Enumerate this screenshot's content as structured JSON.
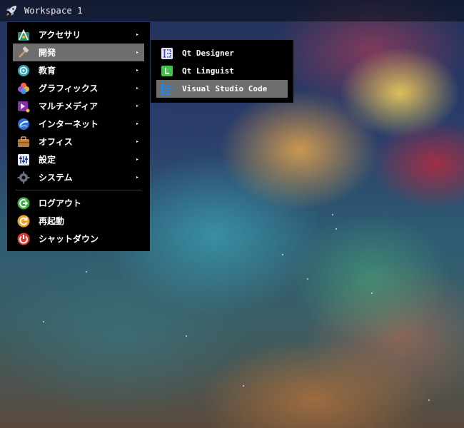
{
  "taskbar": {
    "workspace_label": "Workspace 1",
    "launcher_icon": "rocket-icon"
  },
  "main_menu": {
    "categories": [
      {
        "label": "アクセサリ",
        "icon": "accessories-icon",
        "has_submenu": true,
        "active": false
      },
      {
        "label": "開発",
        "icon": "hammer-icon",
        "has_submenu": true,
        "active": true
      },
      {
        "label": "教育",
        "icon": "education-icon",
        "has_submenu": true,
        "active": false
      },
      {
        "label": "グラフィックス",
        "icon": "graphics-icon",
        "has_submenu": true,
        "active": false
      },
      {
        "label": "マルチメディア",
        "icon": "multimedia-icon",
        "has_submenu": true,
        "active": false
      },
      {
        "label": "インターネット",
        "icon": "internet-icon",
        "has_submenu": true,
        "active": false
      },
      {
        "label": "オフィス",
        "icon": "office-icon",
        "has_submenu": true,
        "active": false
      },
      {
        "label": "設定",
        "icon": "settings-icon",
        "has_submenu": true,
        "active": false
      },
      {
        "label": "システム",
        "icon": "system-gear-icon",
        "has_submenu": true,
        "active": false
      }
    ],
    "session": [
      {
        "label": "ログアウト",
        "icon": "logout-icon"
      },
      {
        "label": "再起動",
        "icon": "restart-icon"
      },
      {
        "label": "シャットダウン",
        "icon": "shutdown-icon"
      }
    ],
    "submenu_arrow": "▸"
  },
  "sub_menu": {
    "parent": "開発",
    "items": [
      {
        "label": "Qt Designer",
        "icon": "qt-designer-icon",
        "active": false
      },
      {
        "label": "Qt Linguist",
        "icon": "qt-linguist-icon",
        "active": false
      },
      {
        "label": "Visual Studio Code",
        "icon": "vscode-icon",
        "active": true
      }
    ]
  },
  "colors": {
    "menu_bg": "#000000",
    "highlight": "#6e6e6e",
    "text": "#ffffff"
  }
}
